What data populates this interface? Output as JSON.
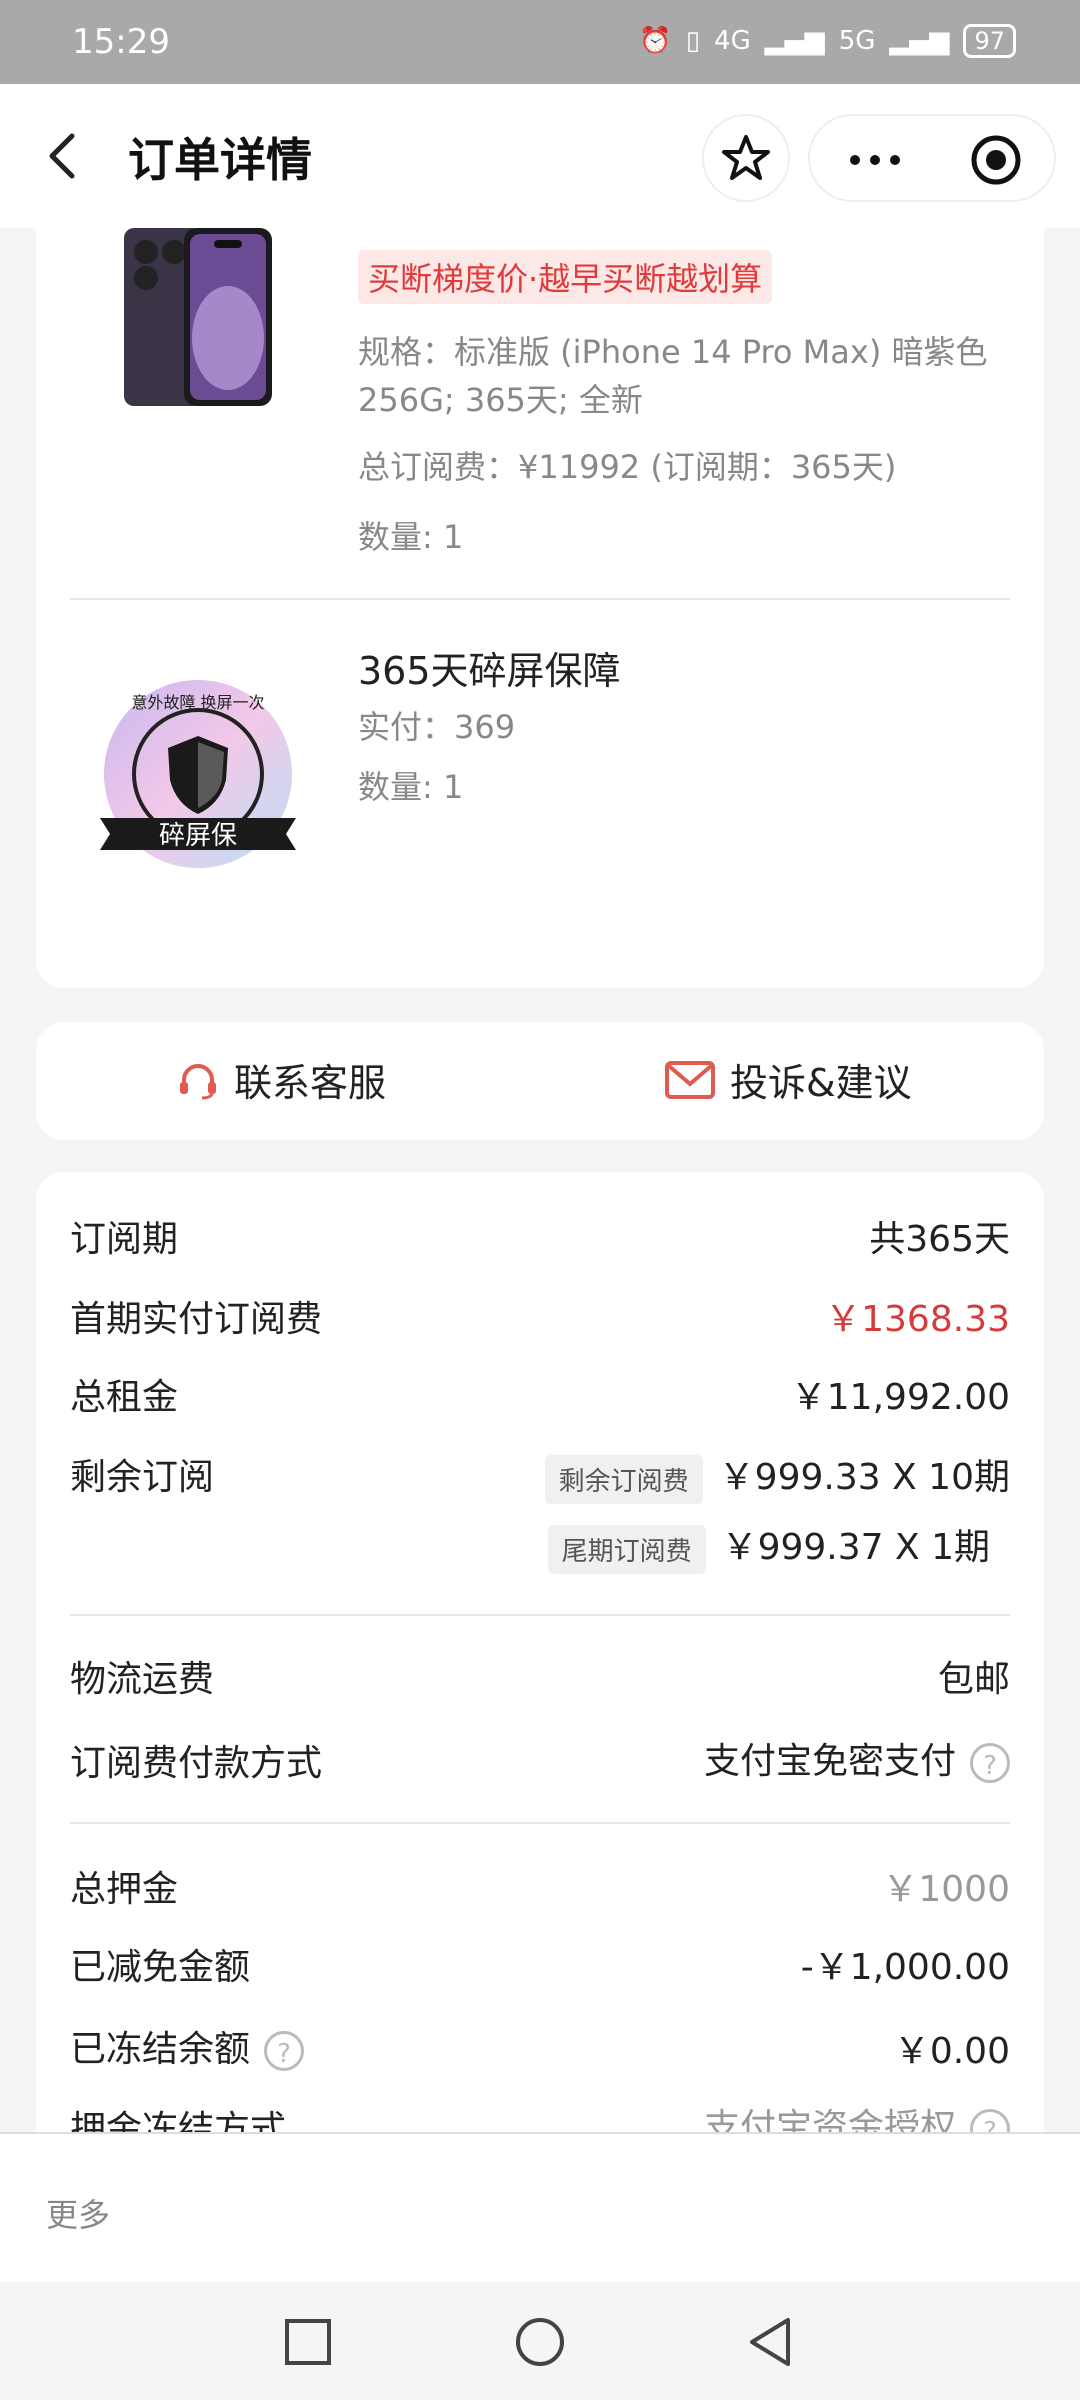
{
  "status_bar": {
    "time": "15:29",
    "signal": "4G",
    "signal2": "5G",
    "battery": "97"
  },
  "nav": {
    "title": "订单详情"
  },
  "product": {
    "promo": "买断梯度价·越早买断越划算",
    "spec": "规格：标准版 (iPhone 14 Pro Max) 暗紫色 256G; 365天; 全新",
    "total_fee": "总订阅费：¥11992 (订阅期：365天)",
    "quantity": "数量: 1"
  },
  "addon": {
    "title": "365天碎屏保障",
    "paid": "实付：369",
    "quantity": "数量: 1",
    "badge_top_text": "意外故障 换屏一次",
    "badge_label": "碎屏保"
  },
  "actions": {
    "contact": "联系客服",
    "complaint": "投诉&建议"
  },
  "details": {
    "subscription_period_label": "订阅期",
    "subscription_period_value": "共365天",
    "first_payment_label": "首期实付订阅费",
    "first_payment_value": "￥1368.33",
    "total_rent_label": "总租金",
    "total_rent_value": "￥11,992.00",
    "remaining_label": "剩余订阅",
    "remaining_tag": "剩余订阅费",
    "remaining_value": "￥999.33 X 10期",
    "final_tag": "尾期订阅费",
    "final_value": "￥999.37 X 1期",
    "shipping_label": "物流运费",
    "shipping_value": "包邮",
    "payment_method_label": "订阅费付款方式",
    "payment_method_value": "支付宝免密支付",
    "deposit_label": "总押金",
    "deposit_value": "￥1000",
    "waived_label": "已减免金额",
    "waived_value": "-￥1,000.00",
    "frozen_label": "已冻结余额",
    "frozen_value": "￥0.00",
    "freeze_method_label": "押金冻结方式",
    "freeze_method_value": "支付宝资金授权"
  },
  "bottom": {
    "more": "更多"
  },
  "colors": {
    "accent_red": "#d63b3b",
    "promo_bg": "#fde8e8"
  }
}
